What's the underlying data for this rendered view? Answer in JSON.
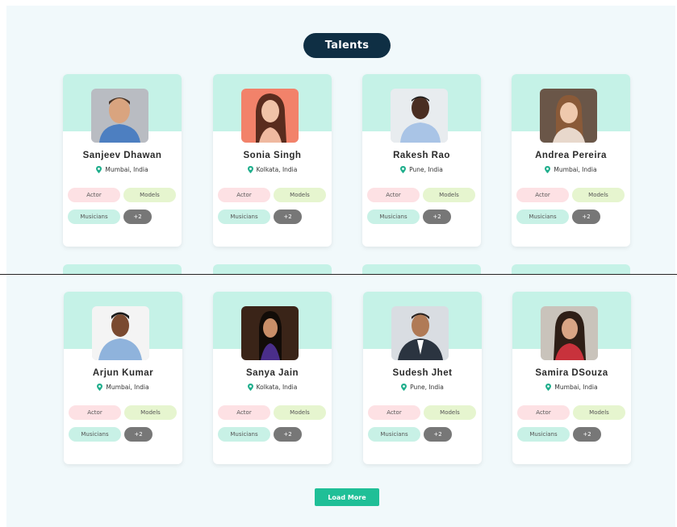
{
  "section": {
    "title": "Talents"
  },
  "tags": {
    "actor": "Actor",
    "models": "Models",
    "musicians": "Musicians",
    "more": "+2"
  },
  "talents": [
    {
      "name": "Sanjeev Dhawan",
      "location": "Mumbai, India"
    },
    {
      "name": "Sonia Singh",
      "location": "Kolkata, India"
    },
    {
      "name": "Rakesh Rao",
      "location": "Pune, India"
    },
    {
      "name": "Andrea Pereira",
      "location": "Mumbai, India"
    },
    {
      "name": "Arjun Kumar",
      "location": "Mumbai, India"
    },
    {
      "name": "Sanya Jain",
      "location": "Kolkata, India"
    },
    {
      "name": "Sudesh Jhet",
      "location": "Pune, India"
    },
    {
      "name": "Samira DSouza",
      "location": "Mumbai, India"
    }
  ],
  "load_more": "Load More",
  "colors": {
    "accent": "#1fbf97",
    "navy": "#0f2f44",
    "banner": "#c5f2e7",
    "pin": "#1fae8c"
  },
  "icons": {
    "location": "location-pin-icon"
  }
}
